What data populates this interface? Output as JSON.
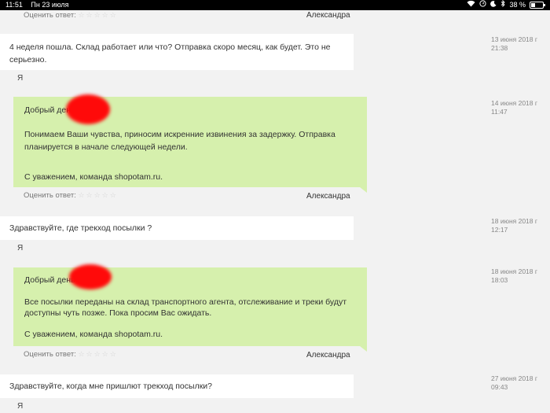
{
  "status_bar": {
    "time": "11:51",
    "date": "Пн 23 июля",
    "battery_pct": "38 %",
    "battery_level": 0.38,
    "icons": [
      "wifi-icon",
      "location-icon",
      "moon-icon",
      "bluetooth-icon",
      "battery-icon"
    ]
  },
  "colors": {
    "staff_bubble": "#d6f0ad",
    "user_bubble": "#ffffff",
    "background": "#f2f2f2",
    "redaction": "#ff0a0a"
  },
  "rating_label": "Оценить ответ:",
  "stars": "☆☆☆☆☆",
  "user_tag": "Я",
  "top_fragment": {
    "staff_name": "Александра"
  },
  "messages": [
    {
      "date": "13 июня 2018 г",
      "time": "21:38",
      "lines": [
        "4 неделя пошла. Склад работает или что? Отправка скоро месяц, как будет. Это не",
        "серьезно."
      ]
    },
    {
      "date": "14 июня 2018 г",
      "time": "11:47",
      "greeting": "Добрый день",
      "lines": [
        "Понимаем Ваши чувства, приносим искренние извинения за задержку. Отправка",
        "планируется в начале следующей недели."
      ],
      "signature": "С уважением, команда shopotam.ru.",
      "staff_name": "Александра"
    },
    {
      "date": "18 июня 2018 г",
      "time": "12:17",
      "lines": [
        "Здравствуйте, где трекход посылки ?"
      ]
    },
    {
      "date": "18 июня 2018 г",
      "time": "18:03",
      "greeting": "Добрый день",
      "lines": [
        "Все посылки переданы на склад транспортного агента, отслеживание и треки будут",
        "доступны чуть позже. Пока просим Вас ожидать."
      ],
      "signature": "С уважением, команда shopotam.ru.",
      "staff_name": "Александра"
    },
    {
      "date": "27 июня 2018 г",
      "time": "09:43",
      "lines": [
        "Здравствуйте, когда мне пришлют трекход посылки?"
      ]
    }
  ]
}
